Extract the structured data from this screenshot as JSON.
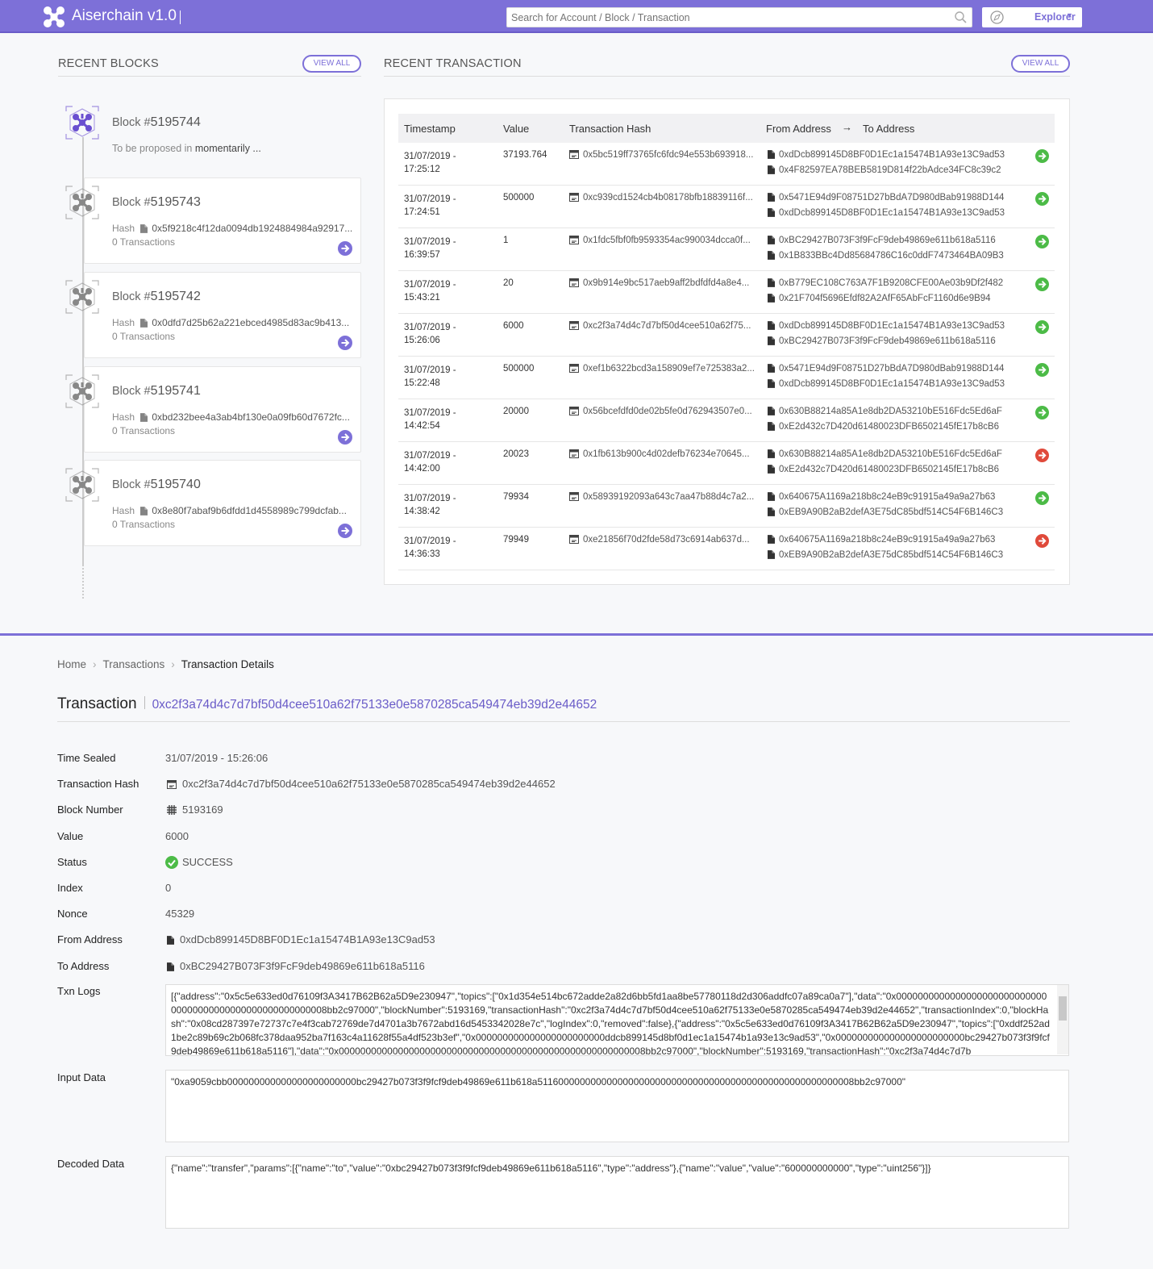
{
  "header": {
    "app_title": "Aiserchain v1.0",
    "search_placeholder": "Search for Account / Block / Transaction",
    "explorer_label": "Explorer",
    "brand_color": "#7d70d8"
  },
  "recent_blocks": {
    "title": "RECENT BLOCKS",
    "view_all": "VIEW ALL",
    "pending": {
      "label": "Block #",
      "number": "5195744",
      "proposed_prefix": "To be proposed in",
      "proposed_value": "momentarily ..."
    },
    "items": [
      {
        "label": "Block #",
        "number": "5195743",
        "hash_label": "Hash",
        "hash": "0x5f9218c4f12da0094db1924884984a92917...",
        "tx_count": "0 Transactions"
      },
      {
        "label": "Block #",
        "number": "5195742",
        "hash_label": "Hash",
        "hash": "0x0dfd7d25b62a221ebced4985d83ac9b413...",
        "tx_count": "0 Transactions"
      },
      {
        "label": "Block #",
        "number": "5195741",
        "hash_label": "Hash",
        "hash": "0xbd232bee4a3ab4bf130e0a09fb60d7672fc...",
        "tx_count": "0 Transactions"
      },
      {
        "label": "Block #",
        "number": "5195740",
        "hash_label": "Hash",
        "hash": "0x8e80f7abaf9b6dfdd1d4558989c799dcfab...",
        "tx_count": "0 Transactions"
      }
    ]
  },
  "recent_transactions": {
    "title": "RECENT TRANSACTION",
    "view_all": "VIEW ALL",
    "columns": {
      "timestamp": "Timestamp",
      "value": "Value",
      "hash": "Transaction Hash",
      "from": "From Address",
      "to": "To Address"
    },
    "rows": [
      {
        "date": "31/07/2019 -",
        "time": "17:25:12",
        "value": "37193.764",
        "hash": "0x5bc519ff73765fc6fdc94e553b693918...",
        "from": "0xdDcb899145D8BF0D1Ec1a15474B1A93e13C9ad53",
        "to": "0x4F82597EA78BEB5819D814f22bAdce34FC8c39c2",
        "status": "success"
      },
      {
        "date": "31/07/2019 -",
        "time": "17:24:51",
        "value": "500000",
        "hash": "0xc939cd1524cb4b08178bfb18839116f...",
        "from": "0x5471E94d9F08751D27bBdA7D980dBab91988D144",
        "to": "0xdDcb899145D8BF0D1Ec1a15474B1A93e13C9ad53",
        "status": "success"
      },
      {
        "date": "31/07/2019 -",
        "time": "16:39:57",
        "value": "1",
        "hash": "0x1fdc5fbf0fb9593354ac990034dcca0f...",
        "from": "0xBC29427B073F3f9FcF9deb49869e611b618a5116",
        "to": "0x1B833BBc4Dd85684786C16c0ddF7473464BA09B3",
        "status": "success"
      },
      {
        "date": "31/07/2019 -",
        "time": "15:43:21",
        "value": "20",
        "hash": "0x9b914e9bc517aeb9aff2bdfdfd4a8e4...",
        "from": "0xB779EC108C763A7F1B9208CFE00Ae03b9Df2f482",
        "to": "0x21F704f5696Efdf82A2AfF65AbFcF1160d6e9B94",
        "status": "success"
      },
      {
        "date": "31/07/2019 -",
        "time": "15:26:06",
        "value": "6000",
        "hash": "0xc2f3a74d4c7d7bf50d4cee510a62f75...",
        "from": "0xdDcb899145D8BF0D1Ec1a15474B1A93e13C9ad53",
        "to": "0xBC29427B073F3f9FcF9deb49869e611b618a5116",
        "status": "success"
      },
      {
        "date": "31/07/2019 -",
        "time": "15:22:48",
        "value": "500000",
        "hash": "0xef1b6322bcd3a158909ef7e725383a2...",
        "from": "0x5471E94d9F08751D27bBdA7D980dBab91988D144",
        "to": "0xdDcb899145D8BF0D1Ec1a15474B1A93e13C9ad53",
        "status": "success"
      },
      {
        "date": "31/07/2019 -",
        "time": "14:42:54",
        "value": "20000",
        "hash": "0x56bcefdfd0de02b5fe0d762943507e0...",
        "from": "0x630B88214a85A1e8db2DA53210bE516Fdc5Ed6aF",
        "to": "0xE2d432c7D420d61480023DFB6502145fE17b8cB6",
        "status": "success"
      },
      {
        "date": "31/07/2019 -",
        "time": "14:42:00",
        "value": "20023",
        "hash": "0x1fb613b900c4d02defb76234e70645...",
        "from": "0x630B88214a85A1e8db2DA53210bE516Fdc5Ed6aF",
        "to": "0xE2d432c7D420d61480023DFB6502145fE17b8cB6",
        "status": "failed"
      },
      {
        "date": "31/07/2019 -",
        "time": "14:38:42",
        "value": "79934",
        "hash": "0x58939192093a643c7aa47b88d4c7a2...",
        "from": "0x640675A1169a218b8c24eB9c91915a49a9a27b63",
        "to": "0xEB9A90B2aB2defA3E75dC85bdf514C54F6B146C3",
        "status": "success"
      },
      {
        "date": "31/07/2019 -",
        "time": "14:36:33",
        "value": "79949",
        "hash": "0xe21856f70d2fde58d73c6914ab637d...",
        "from": "0x640675A1169a218b8c24eB9c91915a49a9a27b63",
        "to": "0xEB9A90B2aB2defA3E75dC85bdf514C54F6B146C3",
        "status": "failed"
      }
    ],
    "status_colors": {
      "success": "#4cbb47",
      "failed": "#e04a3b"
    }
  },
  "breadcrumb": [
    "Home",
    "Transactions",
    "Transaction Details"
  ],
  "transaction": {
    "title": "Transaction",
    "hash": "0xc2f3a74d4c7d7bf50d4cee510a62f75133e0e5870285ca549474eb39d2e44652",
    "fields": {
      "time_sealed": {
        "label": "Time Sealed",
        "value": "31/07/2019 - 15:26:06"
      },
      "tx_hash": {
        "label": "Transaction Hash",
        "value": "0xc2f3a74d4c7d7bf50d4cee510a62f75133e0e5870285ca549474eb39d2e44652"
      },
      "block_number": {
        "label": "Block Number",
        "value": "5193169"
      },
      "value": {
        "label": "Value",
        "value": "6000"
      },
      "status": {
        "label": "Status",
        "value": "SUCCESS"
      },
      "index": {
        "label": "Index",
        "value": "0"
      },
      "nonce": {
        "label": "Nonce",
        "value": "45329"
      },
      "from": {
        "label": "From Address",
        "value": "0xdDcb899145D8BF0D1Ec1a15474B1A93e13C9ad53"
      },
      "to": {
        "label": "To Address",
        "value": "0xBC29427B073F3f9FcF9deb49869e611b618a5116"
      }
    },
    "txn_logs": {
      "label": "Txn Logs",
      "value": "[{\"address\":\"0x5c5e633ed0d76109f3A3417B62B62a5D9e230947\",\"topics\":[\"0x1d354e514bc672adde2a82d6bb5fd1aa8be57780118d2d306addfc07a89ca0a7\"],\"data\":\"0x000000000000000000000000000000000000000000000000000000008bb2c97000\",\"blockNumber\":5193169,\"transactionHash\":\"0xc2f3a74d4c7d7bf50d4cee510a62f75133e0e5870285ca549474eb39d2e44652\",\"transactionIndex\":0,\"blockHash\":\"0x08cd287397e72737c7e4f3cab72769de7d4701a3b7672abd16d5453342028e7c\",\"logIndex\":0,\"removed\":false},{\"address\":\"0x5c5e633ed0d76109f3A3417B62B62a5D9e230947\",\"topics\":[\"0xddf252ad1be2c89b69c2b068fc378daa952ba7f163c4a11628f55a4df523b3ef\",\"0x000000000000000000000000ddcb899145d8bf0d1ec1a15474b1a93e13c9ad53\",\"0x000000000000000000000000bc29427b073f3f9fcf9deb49869e611b618a5116\"],\"data\":\"0x000000000000000000000000000000000000000000000000000000008bb2c97000\",\"blockNumber\":5193169,\"transactionHash\":\"0xc2f3a74d4c7d7b"
    },
    "input_data": {
      "label": "Input Data",
      "value": "\"0xa9059cbb000000000000000000000000bc29427b073f3f9fcf9deb49869e611b618a51160000000000000000000000000000000000000000000000000000008bb2c97000\""
    },
    "decoded_data": {
      "label": "Decoded Data",
      "value": "{\"name\":\"transfer\",\"params\":[{\"name\":\"to\",\"value\":\"0xbc29427b073f3f9fcf9deb49869e611b618a5116\",\"type\":\"address\"},{\"name\":\"value\",\"value\":\"600000000000\",\"type\":\"uint256\"}]}"
    }
  }
}
